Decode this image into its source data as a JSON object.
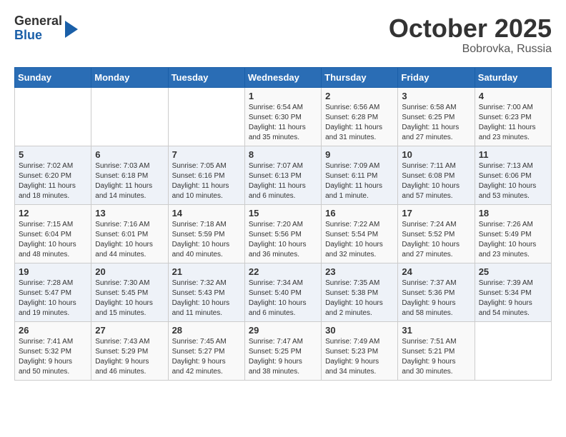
{
  "header": {
    "logo_general": "General",
    "logo_blue": "Blue",
    "title": "October 2025",
    "subtitle": "Bobrovka, Russia"
  },
  "columns": [
    "Sunday",
    "Monday",
    "Tuesday",
    "Wednesday",
    "Thursday",
    "Friday",
    "Saturday"
  ],
  "weeks": [
    [
      {
        "day": "",
        "info": ""
      },
      {
        "day": "",
        "info": ""
      },
      {
        "day": "",
        "info": ""
      },
      {
        "day": "1",
        "info": "Sunrise: 6:54 AM\nSunset: 6:30 PM\nDaylight: 11 hours\nand 35 minutes."
      },
      {
        "day": "2",
        "info": "Sunrise: 6:56 AM\nSunset: 6:28 PM\nDaylight: 11 hours\nand 31 minutes."
      },
      {
        "day": "3",
        "info": "Sunrise: 6:58 AM\nSunset: 6:25 PM\nDaylight: 11 hours\nand 27 minutes."
      },
      {
        "day": "4",
        "info": "Sunrise: 7:00 AM\nSunset: 6:23 PM\nDaylight: 11 hours\nand 23 minutes."
      }
    ],
    [
      {
        "day": "5",
        "info": "Sunrise: 7:02 AM\nSunset: 6:20 PM\nDaylight: 11 hours\nand 18 minutes."
      },
      {
        "day": "6",
        "info": "Sunrise: 7:03 AM\nSunset: 6:18 PM\nDaylight: 11 hours\nand 14 minutes."
      },
      {
        "day": "7",
        "info": "Sunrise: 7:05 AM\nSunset: 6:16 PM\nDaylight: 11 hours\nand 10 minutes."
      },
      {
        "day": "8",
        "info": "Sunrise: 7:07 AM\nSunset: 6:13 PM\nDaylight: 11 hours\nand 6 minutes."
      },
      {
        "day": "9",
        "info": "Sunrise: 7:09 AM\nSunset: 6:11 PM\nDaylight: 11 hours\nand 1 minute."
      },
      {
        "day": "10",
        "info": "Sunrise: 7:11 AM\nSunset: 6:08 PM\nDaylight: 10 hours\nand 57 minutes."
      },
      {
        "day": "11",
        "info": "Sunrise: 7:13 AM\nSunset: 6:06 PM\nDaylight: 10 hours\nand 53 minutes."
      }
    ],
    [
      {
        "day": "12",
        "info": "Sunrise: 7:15 AM\nSunset: 6:04 PM\nDaylight: 10 hours\nand 48 minutes."
      },
      {
        "day": "13",
        "info": "Sunrise: 7:16 AM\nSunset: 6:01 PM\nDaylight: 10 hours\nand 44 minutes."
      },
      {
        "day": "14",
        "info": "Sunrise: 7:18 AM\nSunset: 5:59 PM\nDaylight: 10 hours\nand 40 minutes."
      },
      {
        "day": "15",
        "info": "Sunrise: 7:20 AM\nSunset: 5:56 PM\nDaylight: 10 hours\nand 36 minutes."
      },
      {
        "day": "16",
        "info": "Sunrise: 7:22 AM\nSunset: 5:54 PM\nDaylight: 10 hours\nand 32 minutes."
      },
      {
        "day": "17",
        "info": "Sunrise: 7:24 AM\nSunset: 5:52 PM\nDaylight: 10 hours\nand 27 minutes."
      },
      {
        "day": "18",
        "info": "Sunrise: 7:26 AM\nSunset: 5:49 PM\nDaylight: 10 hours\nand 23 minutes."
      }
    ],
    [
      {
        "day": "19",
        "info": "Sunrise: 7:28 AM\nSunset: 5:47 PM\nDaylight: 10 hours\nand 19 minutes."
      },
      {
        "day": "20",
        "info": "Sunrise: 7:30 AM\nSunset: 5:45 PM\nDaylight: 10 hours\nand 15 minutes."
      },
      {
        "day": "21",
        "info": "Sunrise: 7:32 AM\nSunset: 5:43 PM\nDaylight: 10 hours\nand 11 minutes."
      },
      {
        "day": "22",
        "info": "Sunrise: 7:34 AM\nSunset: 5:40 PM\nDaylight: 10 hours\nand 6 minutes."
      },
      {
        "day": "23",
        "info": "Sunrise: 7:35 AM\nSunset: 5:38 PM\nDaylight: 10 hours\nand 2 minutes."
      },
      {
        "day": "24",
        "info": "Sunrise: 7:37 AM\nSunset: 5:36 PM\nDaylight: 9 hours\nand 58 minutes."
      },
      {
        "day": "25",
        "info": "Sunrise: 7:39 AM\nSunset: 5:34 PM\nDaylight: 9 hours\nand 54 minutes."
      }
    ],
    [
      {
        "day": "26",
        "info": "Sunrise: 7:41 AM\nSunset: 5:32 PM\nDaylight: 9 hours\nand 50 minutes."
      },
      {
        "day": "27",
        "info": "Sunrise: 7:43 AM\nSunset: 5:29 PM\nDaylight: 9 hours\nand 46 minutes."
      },
      {
        "day": "28",
        "info": "Sunrise: 7:45 AM\nSunset: 5:27 PM\nDaylight: 9 hours\nand 42 minutes."
      },
      {
        "day": "29",
        "info": "Sunrise: 7:47 AM\nSunset: 5:25 PM\nDaylight: 9 hours\nand 38 minutes."
      },
      {
        "day": "30",
        "info": "Sunrise: 7:49 AM\nSunset: 5:23 PM\nDaylight: 9 hours\nand 34 minutes."
      },
      {
        "day": "31",
        "info": "Sunrise: 7:51 AM\nSunset: 5:21 PM\nDaylight: 9 hours\nand 30 minutes."
      },
      {
        "day": "",
        "info": ""
      }
    ]
  ]
}
